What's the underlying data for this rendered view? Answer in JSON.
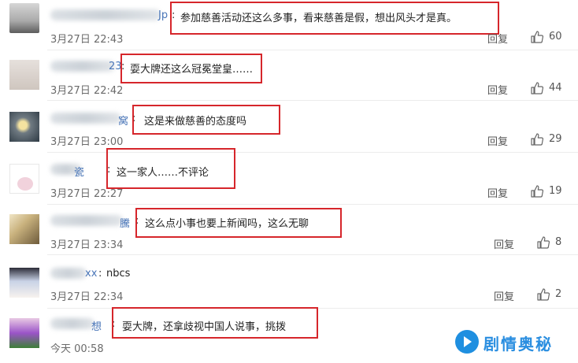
{
  "comments": [
    {
      "name": "Jp",
      "text": "参加慈善活动还这么多事，看来慈善是假，想出风头才是真。",
      "date": "3月27日 22:43",
      "reply": "回复",
      "likes": "60"
    },
    {
      "name": "23",
      "text": "耍大牌还这么冠冕堂皇……",
      "date": "3月27日 22:42",
      "reply": "回复",
      "likes": "44"
    },
    {
      "name": "窝",
      "text": "这是来做慈善的态度吗",
      "date": "3月27日 23:00",
      "reply": "回复",
      "likes": "29"
    },
    {
      "name": "瓷",
      "text": "这一家人……不评论",
      "date": "3月27日 22:27",
      "reply": "回复",
      "likes": "19"
    },
    {
      "name": "騰",
      "text": "这么点小事也要上新闻吗，这么无聊",
      "date": "3月27日 23:34",
      "reply": "回复",
      "likes": "8"
    },
    {
      "name": "xx",
      "text": "nbcs",
      "date": "3月27日 22:34",
      "reply": "回复",
      "likes": "2"
    },
    {
      "name": "想",
      "text": "耍大牌，还拿歧视中国人说事，挑拨",
      "date": "今天 00:58",
      "reply": "",
      "likes": ""
    }
  ],
  "watermark": {
    "text": "剧情奥秘",
    "icon": "play-icon",
    "color": "#2a8ee0"
  },
  "colors": {
    "highlight_box": "#d6262b",
    "username": "#4a76b8"
  }
}
